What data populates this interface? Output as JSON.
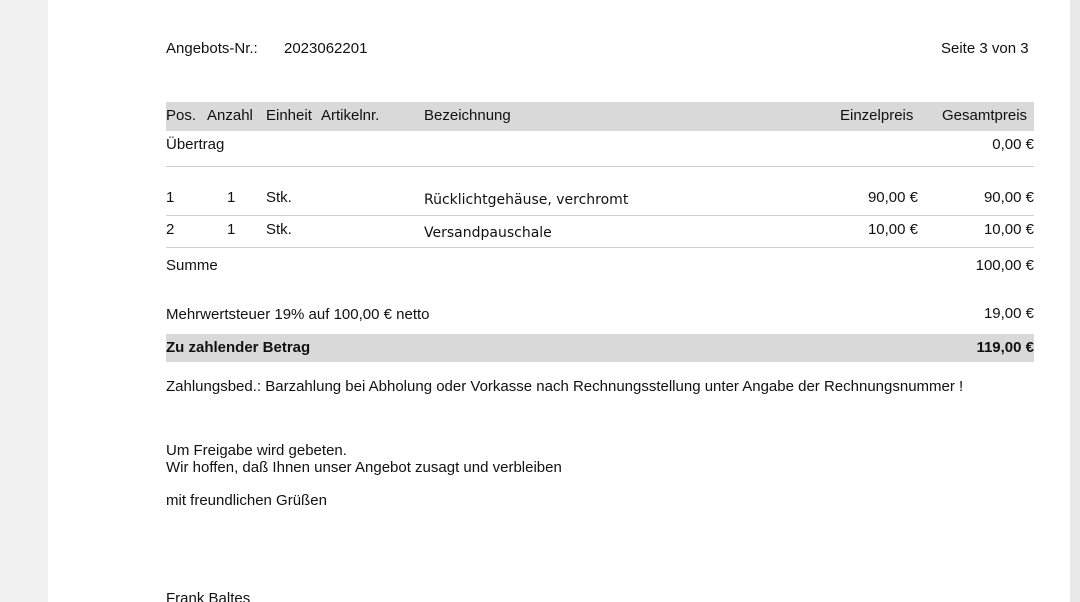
{
  "header": {
    "offer_label": "Angebots-Nr.:",
    "offer_number": "2023062201",
    "page_info": "Seite 3 von 3"
  },
  "table": {
    "columns": [
      "Pos.",
      "Anzahl",
      "Einheit",
      "Artikelnr.",
      "Bezeichnung",
      "Einzelpreis",
      "Gesamtpreis"
    ],
    "carryover": {
      "label": "Übertrag",
      "value": "0,00 €"
    },
    "rows": [
      {
        "pos": "1",
        "qty": "1",
        "unit": "Stk.",
        "article": "",
        "description": "Rücklichtgehäuse, verchromt",
        "unit_price": "90,00 €",
        "total": "90,00 €"
      },
      {
        "pos": "2",
        "qty": "1",
        "unit": "Stk.",
        "article": "",
        "description": "Versandpauschale",
        "unit_price": "10,00 €",
        "total": "10,00 €"
      }
    ],
    "sum": {
      "label": "Summe",
      "value": "100,00 €"
    },
    "vat": {
      "label": "Mehrwertsteuer 19% auf 100,00 € netto",
      "value": "19,00 €"
    },
    "total_due": {
      "label": "Zu zahlender Betrag",
      "value": "119,00 €"
    }
  },
  "payment_terms": "Zahlungsbed.: Barzahlung bei Abholung oder Vorkasse nach Rechnungsstellung unter Angabe der Rechnungsnummer !",
  "closing": {
    "line1": "Um Freigabe wird gebeten.",
    "line2": "Wir hoffen, daß Ihnen unser Angebot zusagt und verbleiben",
    "greeting": "mit freundlichen Grüßen",
    "signature": "Frank Baltes"
  }
}
